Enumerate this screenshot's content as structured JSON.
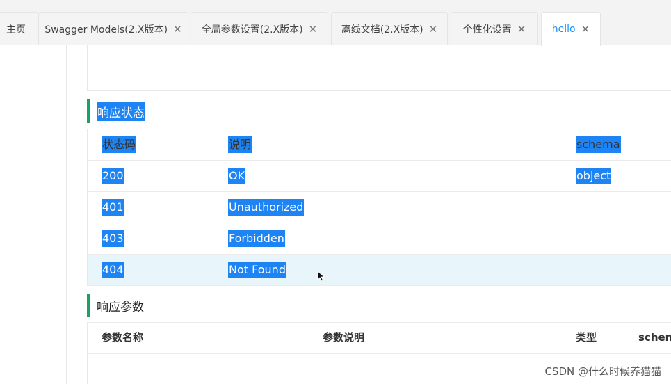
{
  "tabs": [
    {
      "label": "主页",
      "closable": false
    },
    {
      "label": "Swagger Models(2.X版本)",
      "closable": true
    },
    {
      "label": "全局参数设置(2.X版本)",
      "closable": true
    },
    {
      "label": "离线文档(2.X版本)",
      "closable": true
    },
    {
      "label": "个性化设置",
      "closable": true
    },
    {
      "label": "hello",
      "closable": true,
      "active": true
    }
  ],
  "close_glyph": "✕",
  "response_status": {
    "title": "响应状态",
    "headers": [
      "状态码",
      "说明",
      "schema"
    ],
    "rows": [
      {
        "code": "200",
        "desc": "OK",
        "schema": "object"
      },
      {
        "code": "401",
        "desc": "Unauthorized",
        "schema": ""
      },
      {
        "code": "403",
        "desc": "Forbidden",
        "schema": ""
      },
      {
        "code": "404",
        "desc": "Not Found",
        "schema": ""
      }
    ]
  },
  "response_params": {
    "title": "响应参数",
    "headers": [
      "参数名称",
      "参数说明",
      "类型",
      "schem"
    ]
  },
  "watermark": "CSDN @什么时候养猫猫",
  "colors": {
    "accent_green": "#1aa260",
    "selection": "#1e84f4",
    "active_tab": "#1890ff"
  }
}
